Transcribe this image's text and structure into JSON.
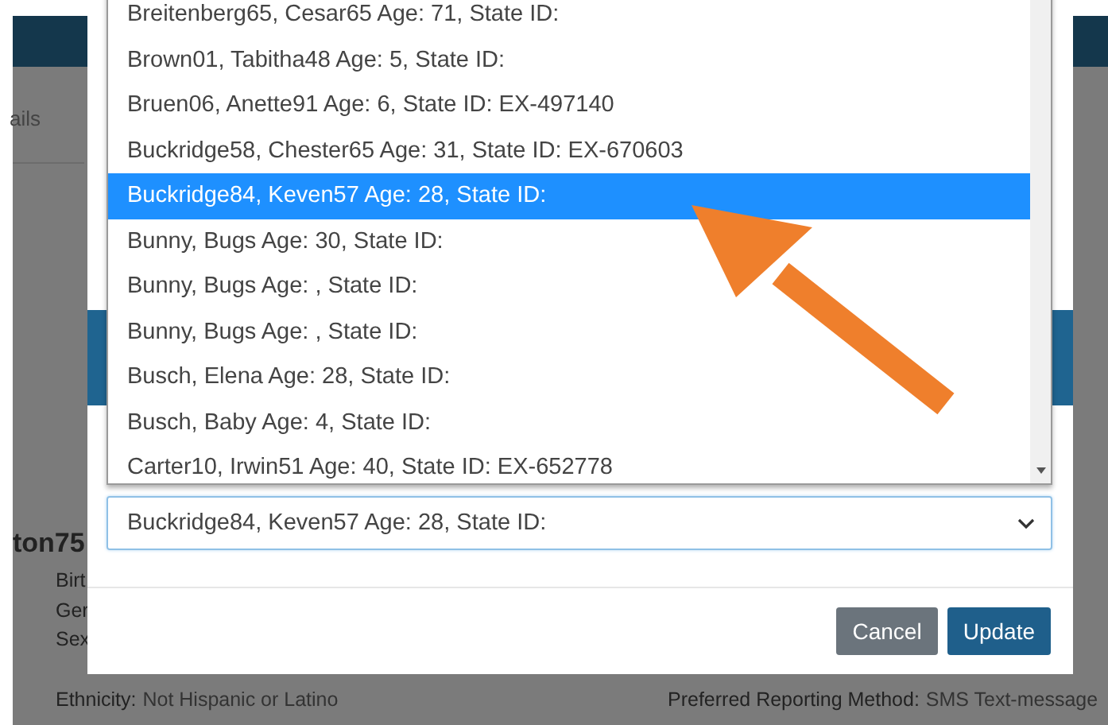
{
  "background_page": {
    "tab_label": "ails",
    "heading": "ton75",
    "fields_left": [
      {
        "label": "Birt"
      },
      {
        "label": "Ger"
      },
      {
        "label": "Sex"
      },
      {
        "label": "Ethnicity:",
        "value": "Not Hispanic or Latino"
      }
    ],
    "fields_right": [
      {
        "label": "Preferred Reporting Method:",
        "value": "SMS Text-message"
      }
    ]
  },
  "dialog": {
    "select": {
      "value": "Buckridge84, Keven57 Age: 28, State ID:",
      "expanded": true,
      "options": [
        {
          "label": "Breitenberg65, Cesar65 Age: 71, State ID:",
          "selected": false
        },
        {
          "label": "Brown01, Tabitha48 Age: 5, State ID:",
          "selected": false
        },
        {
          "label": "Bruen06, Anette91 Age: 6, State ID: EX-497140",
          "selected": false
        },
        {
          "label": "Buckridge58, Chester65 Age: 31, State ID: EX-670603",
          "selected": false
        },
        {
          "label": "Buckridge84, Keven57 Age: 28, State ID:",
          "selected": true
        },
        {
          "label": "Bunny, Bugs Age: 30, State ID:",
          "selected": false
        },
        {
          "label": "Bunny, Bugs Age: , State ID:",
          "selected": false
        },
        {
          "label": "Bunny, Bugs Age: , State ID:",
          "selected": false
        },
        {
          "label": "Busch, Elena Age: 28, State ID:",
          "selected": false
        },
        {
          "label": "Busch, Baby Age: 4, State ID:",
          "selected": false
        },
        {
          "label": "Carter10, Irwin51 Age: 40, State ID: EX-652778",
          "selected": false
        }
      ]
    },
    "buttons": [
      {
        "label": "Cancel",
        "kind": "secondary"
      },
      {
        "label": "Update",
        "kind": "primary"
      }
    ]
  }
}
